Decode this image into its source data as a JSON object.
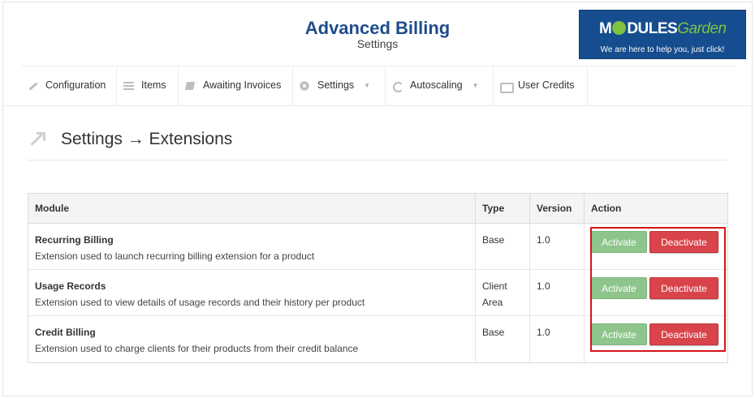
{
  "header": {
    "title": "Advanced Billing",
    "subtitle": "Settings"
  },
  "logo": {
    "brand_part1": "M",
    "brand_part2": "DULES",
    "brand_part3": "Garden",
    "tagline": "We are here to help you, just click!",
    "colors": {
      "background": "#164d8e",
      "accent": "#7dc242"
    }
  },
  "nav": {
    "items": [
      {
        "label": "Configuration",
        "icon": "wrench-icon"
      },
      {
        "label": "Items",
        "icon": "list-icon"
      },
      {
        "label": "Awaiting Invoices",
        "icon": "book-icon"
      },
      {
        "label": "Settings",
        "icon": "gear-icon",
        "dropdown": true
      },
      {
        "label": "Autoscaling",
        "icon": "refresh-icon",
        "dropdown": true
      },
      {
        "label": "User Credits",
        "icon": "money-icon"
      }
    ]
  },
  "page": {
    "title": "Settings → Extensions"
  },
  "table": {
    "headers": [
      "Module",
      "Type",
      "Version",
      "Action"
    ],
    "rows": [
      {
        "name": "Recurring Billing",
        "description": "Extension used to launch recurring billing extension for a product",
        "type_line1": "Base",
        "type_line2": "",
        "version": "1.0",
        "activate_label": "Activate",
        "deactivate_label": "Deactivate"
      },
      {
        "name": "Usage Records",
        "description": "Extension used to view details of usage records and their history per product",
        "type_line1": "Client",
        "type_line2": "Area",
        "version": "1.0",
        "activate_label": "Activate",
        "deactivate_label": "Deactivate"
      },
      {
        "name": "Credit Billing",
        "description": "Extension used to charge clients for their products from their credit balance",
        "type_line1": "Base",
        "type_line2": "",
        "version": "1.0",
        "activate_label": "Activate",
        "deactivate_label": "Deactivate"
      }
    ]
  },
  "colors": {
    "title": "#1e4d8c",
    "activate": "#8dc58c",
    "deactivate": "#d9434a",
    "highlight": "#d6131b"
  }
}
